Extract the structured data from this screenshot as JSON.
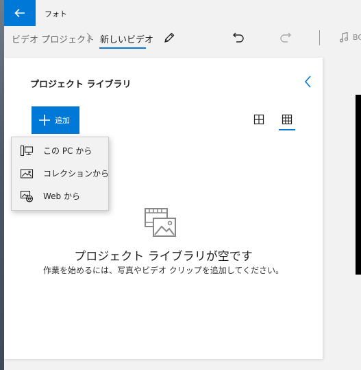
{
  "app": {
    "title": "フォト"
  },
  "breadcrumb": {
    "root": "ビデオ プロジェクト",
    "current": "新しいビデオ"
  },
  "toolbar": {
    "music_label": "BGM"
  },
  "library": {
    "title": "プロジェクト ライブラリ",
    "add_label": "追加",
    "empty_title": "プロジェクト ライブラリが空です",
    "empty_subtitle": "作業を始めるには、写真やビデオ クリップを追加してください。"
  },
  "add_menu": {
    "items": [
      {
        "label": "この PC から",
        "icon": "pc-icon"
      },
      {
        "label": "コレクションから",
        "icon": "collection-icon"
      },
      {
        "label": "Web から",
        "icon": "web-icon"
      }
    ]
  },
  "colors": {
    "accent": "#0078d7",
    "panel": "#ffffff",
    "chrome": "#f2f2f2"
  }
}
